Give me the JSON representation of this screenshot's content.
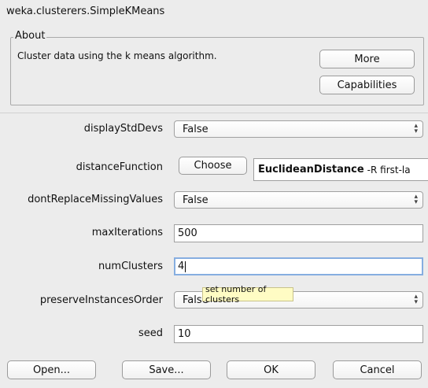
{
  "window": {
    "title": "weka.clusterers.SimpleKMeans"
  },
  "about": {
    "legend": "About",
    "description": "Cluster data using the k means algorithm.",
    "more_label": "More",
    "capabilities_label": "Capabilities"
  },
  "properties": {
    "displayStdDevs": {
      "label": "displayStdDevs",
      "value": "False"
    },
    "distanceFunction": {
      "label": "distanceFunction",
      "choose_label": "Choose",
      "name": "EuclideanDistance",
      "options": "-R first-la"
    },
    "dontReplaceMissingValues": {
      "label": "dontReplaceMissingValues",
      "value": "False"
    },
    "maxIterations": {
      "label": "maxIterations",
      "value": "500"
    },
    "numClusters": {
      "label": "numClusters",
      "value": "4"
    },
    "preserveInstancesOrder": {
      "label": "preserveInstancesOrder",
      "value": "False"
    },
    "seed": {
      "label": "seed",
      "value": "10"
    }
  },
  "tooltip": {
    "text": "set number of clusters"
  },
  "buttons": {
    "open": "Open...",
    "save": "Save...",
    "ok": "OK",
    "cancel": "Cancel"
  },
  "colors": {
    "tooltip_bg": "#fffcc4",
    "focus_border": "#86aee0",
    "window_bg": "#ececec"
  },
  "icons": {
    "combo_arrow": "up-down-arrow-icon"
  }
}
